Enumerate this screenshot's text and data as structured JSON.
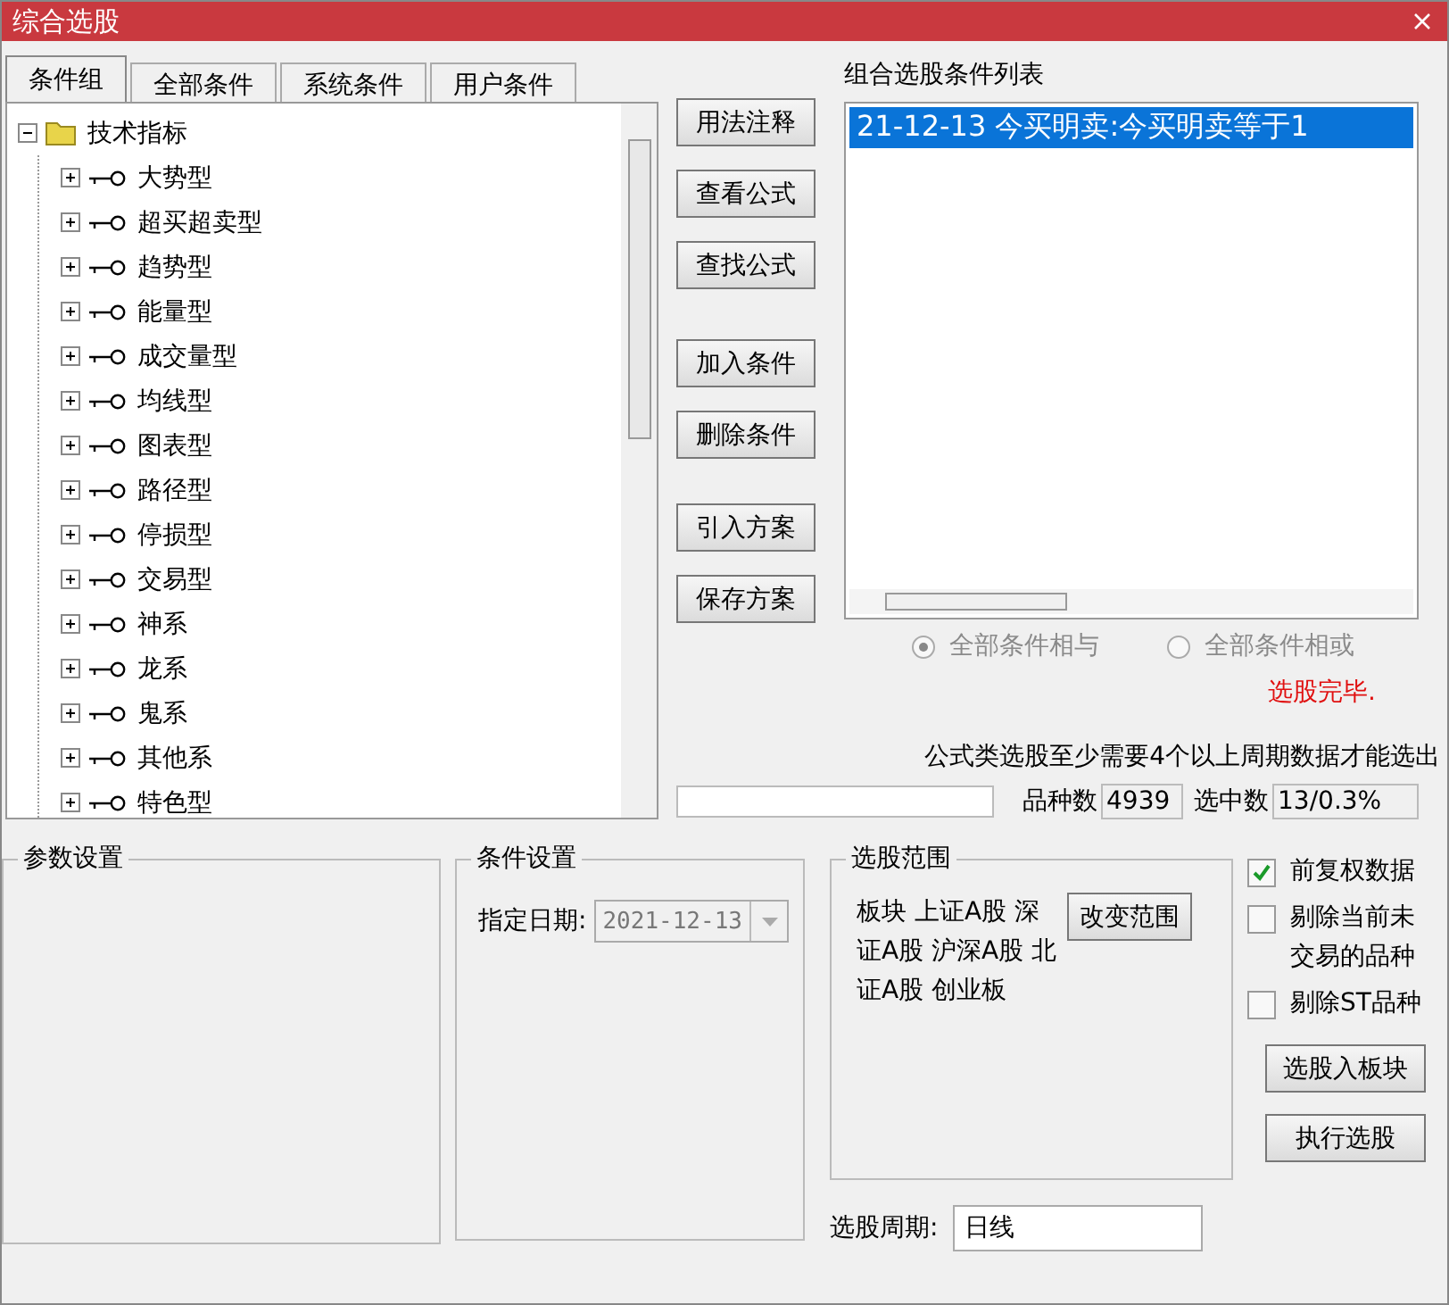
{
  "window": {
    "title": "综合选股"
  },
  "tabs": [
    {
      "label": "条件组",
      "selected": true
    },
    {
      "label": "全部条件",
      "selected": false
    },
    {
      "label": "系统条件",
      "selected": false
    },
    {
      "label": "用户条件",
      "selected": false
    }
  ],
  "tree": {
    "items": [
      {
        "label": "技术指标",
        "expanded": true,
        "children": [
          {
            "label": "大势型",
            "expanded": false
          },
          {
            "label": "超买超卖型",
            "expanded": false
          },
          {
            "label": "趋势型",
            "expanded": false
          },
          {
            "label": "能量型",
            "expanded": false
          },
          {
            "label": "成交量型",
            "expanded": false
          },
          {
            "label": "均线型",
            "expanded": false
          },
          {
            "label": "图表型",
            "expanded": false
          },
          {
            "label": "路径型",
            "expanded": false
          },
          {
            "label": "停损型",
            "expanded": false
          },
          {
            "label": "交易型",
            "expanded": false
          },
          {
            "label": "神系",
            "expanded": false
          },
          {
            "label": "龙系",
            "expanded": false
          },
          {
            "label": "鬼系",
            "expanded": false
          },
          {
            "label": "其他系",
            "expanded": false
          },
          {
            "label": "特色型",
            "expanded": false
          }
        ]
      }
    ]
  },
  "side_buttons": [
    "用法注释",
    "查看公式",
    "查找公式",
    "加入条件",
    "删除条件",
    "引入方案",
    "保存方案"
  ],
  "condition_list": {
    "title": "组合选股条件列表",
    "items": [
      {
        "text": "21-12-13 今买明卖:今买明卖等于1",
        "selected": true
      }
    ]
  },
  "logic_options": [
    {
      "label": "全部条件相与",
      "selected": true,
      "disabled": true
    },
    {
      "label": "全部条件相或",
      "selected": false,
      "disabled": true
    }
  ],
  "status": {
    "message": "选股完毕.",
    "note": "公式类选股至少需要4个以上周期数据才能选出"
  },
  "counts": [
    {
      "label": "品种数",
      "value": "4939"
    },
    {
      "label": "选中数",
      "value": "13/0.3%"
    }
  ],
  "param_group": {
    "title": "参数设置"
  },
  "condition_group": {
    "title": "条件设置",
    "date_label": "指定日期:",
    "date_value": "2021-12-13",
    "disabled": true
  },
  "scope_group": {
    "title": "选股范围",
    "text": "板块 上证A股 深证A股 沪深A股 北证A股 创业板",
    "button": "改变范围"
  },
  "options": [
    {
      "label": "前复权数据",
      "checked": true
    },
    {
      "label": "剔除当前未交易的品种",
      "checked": false
    },
    {
      "label": "剔除ST品种",
      "checked": false
    }
  ],
  "action_buttons": [
    "选股入板块",
    "执行选股"
  ],
  "period": {
    "label": "选股周期:",
    "value": "日线"
  }
}
